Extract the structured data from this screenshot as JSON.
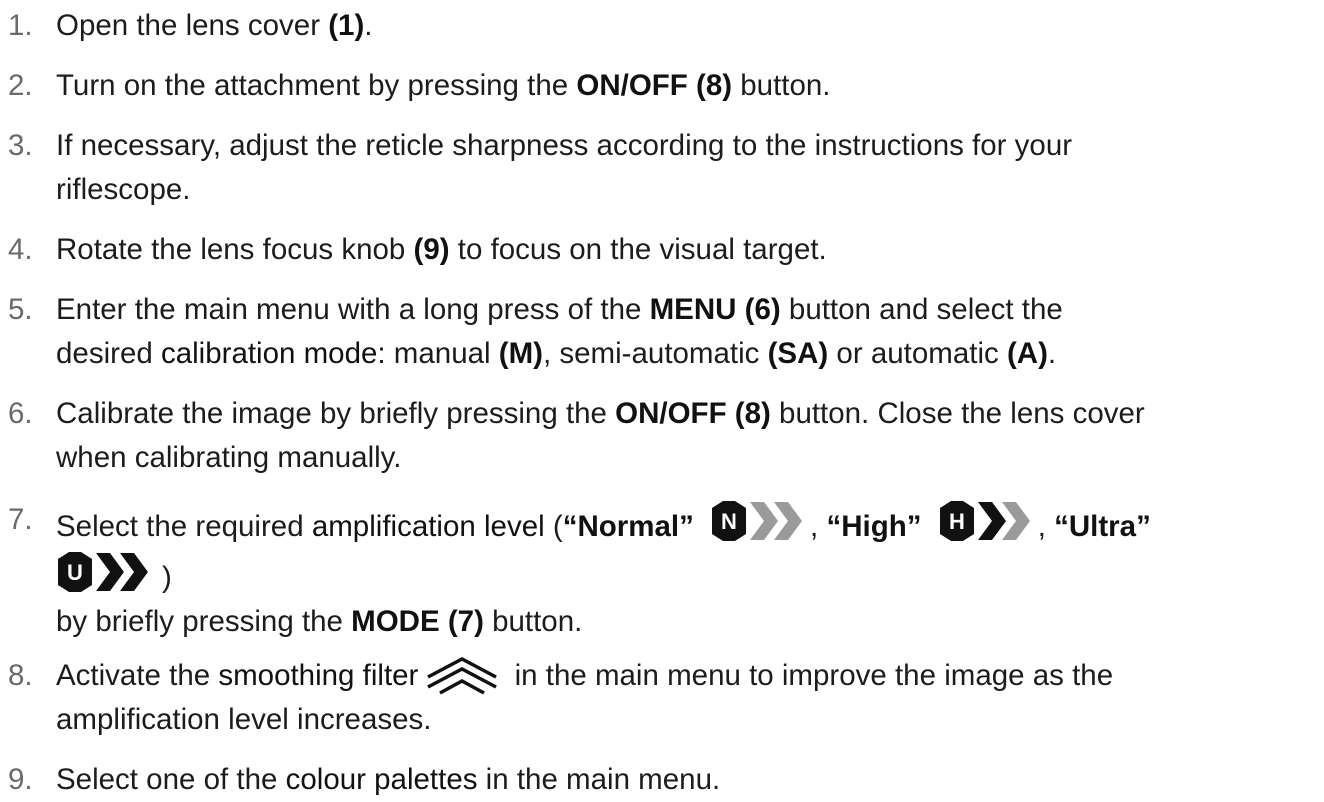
{
  "steps": [
    {
      "num": "1.",
      "lines": [
        [
          "Open the lens cover ",
          "(1)",
          "."
        ]
      ]
    },
    {
      "num": "2.",
      "lines": [
        [
          "Turn on the attachment by pressing the ",
          "ON/OFF (8)",
          " button."
        ]
      ]
    },
    {
      "num": "3.",
      "lines": [
        [
          "If necessary, adjust the reticle sharpness according to the instructions for your"
        ],
        [
          "riflescope."
        ]
      ]
    },
    {
      "num": "4.",
      "lines": [
        [
          "Rotate the lens focus knob ",
          "(9)",
          " to focus on the visual target."
        ]
      ]
    },
    {
      "num": "5.",
      "lines": [
        [
          "Enter the main menu with a long press of the ",
          "MENU (6)",
          " button and select the"
        ],
        [
          "desired ",
          "calibration mode:",
          " manual ",
          "(M)",
          ", semi-automatic ",
          "(SA)",
          " or automatic ",
          "(A)",
          "."
        ]
      ]
    },
    {
      "num": "6.",
      "lines": [
        [
          "Calibrate the image by briefly pressing the ",
          "ON/OFF (8)",
          " button. Close the lens cover"
        ],
        [
          "when calibrating manually."
        ]
      ]
    },
    {
      "num": "7.",
      "line1": [
        "Select the required ",
        "amplification level",
        " (",
        "“Normal”",
        ", ",
        "“High”",
        ", ",
        "“Ultra”"
      ],
      "line2_close": ")",
      "line3": [
        "by briefly pressing the ",
        "MODE (7)",
        " button."
      ],
      "badges": {
        "normal": "N",
        "high": "H",
        "ultra": "U"
      }
    },
    {
      "num": "8.",
      "line1": [
        "Activate the ",
        "smoothing filter",
        " in the main menu to improve the image as the"
      ],
      "line2": [
        "amplification level increases."
      ],
      "icon": "smoothing-filter-icon"
    },
    {
      "num": "9.",
      "lines": [
        [
          "Select one of the ",
          "colour palettes",
          " in the main menu."
        ]
      ]
    }
  ],
  "colors": {
    "text": "#1c1c1c",
    "number": "#6a6a6a",
    "badge_dark": "#111111",
    "badge_gray": "#9a9a9a"
  }
}
